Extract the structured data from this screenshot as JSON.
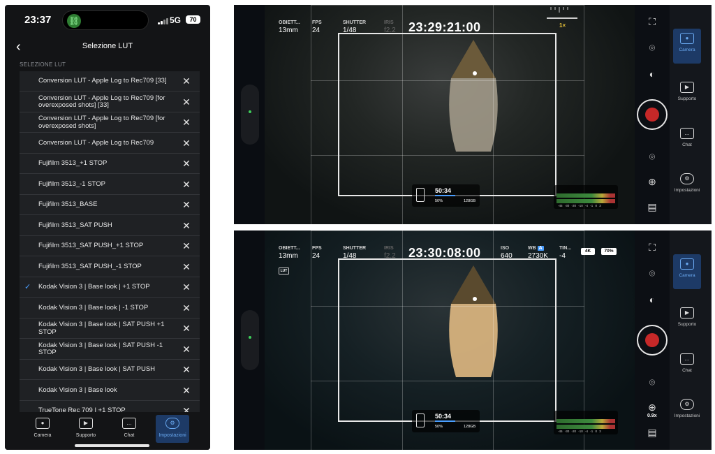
{
  "phone": {
    "status": {
      "time": "23:37",
      "network": "5G",
      "battery": "70"
    },
    "nav": {
      "back_icon": "chevron-left-icon",
      "title": "Selezione LUT"
    },
    "section_label": "SELEZIONE LUT",
    "luts": [
      {
        "label": "Conversion LUT - Apple Log to Rec709 [33]",
        "selected": false
      },
      {
        "label": "Conversion LUT - Apple Log to Rec709 [for overexposed shots] [33]",
        "selected": false
      },
      {
        "label": "Conversion LUT - Apple Log to Rec709 [for overexposed shots]",
        "selected": false
      },
      {
        "label": "Conversion LUT - Apple Log to Rec709",
        "selected": false
      },
      {
        "label": "Fujifilm 3513_+1 STOP",
        "selected": false
      },
      {
        "label": "Fujifilm 3513_-1 STOP",
        "selected": false
      },
      {
        "label": "Fujifilm 3513_BASE",
        "selected": false
      },
      {
        "label": "Fujifilm 3513_SAT PUSH",
        "selected": false
      },
      {
        "label": "Fujifilm 3513_SAT PUSH_+1 STOP",
        "selected": false
      },
      {
        "label": "Fujifilm 3513_SAT PUSH_-1 STOP",
        "selected": false
      },
      {
        "label": "Kodak Vision 3 | Base look | +1 STOP",
        "selected": true
      },
      {
        "label": "Kodak Vision 3 | Base look | -1 STOP",
        "selected": false
      },
      {
        "label": "Kodak Vision 3 | Base look | SAT PUSH +1 STOP",
        "selected": false
      },
      {
        "label": "Kodak Vision 3 | Base look | SAT PUSH -1 STOP",
        "selected": false
      },
      {
        "label": "Kodak Vision 3 | Base look | SAT PUSH",
        "selected": false
      },
      {
        "label": "Kodak Vision 3 | Base look",
        "selected": false
      },
      {
        "label": "TrueTone Rec 709 | +1 STOP",
        "selected": false
      }
    ],
    "tabs": [
      {
        "label": "Camera",
        "icon": "camera-icon",
        "active": false
      },
      {
        "label": "Supporto",
        "icon": "play-icon",
        "active": false
      },
      {
        "label": "Chat",
        "icon": "chat-icon",
        "active": false
      },
      {
        "label": "Impostazioni",
        "icon": "gear-icon",
        "active": true
      }
    ],
    "colors": {
      "accent": "#4a9eff",
      "active_tab_bg": "#1d3a66"
    }
  },
  "camera_screens": [
    {
      "lens": {
        "label": "OBIETT...",
        "value": "13mm"
      },
      "fps": {
        "label": "FPS",
        "value": "24"
      },
      "shutter": {
        "label": "SHUTTER",
        "value": "1/48"
      },
      "iris": {
        "label": "IRIS",
        "value": "f2.2"
      },
      "timecode": "23:29:21:00",
      "zoom": "1×",
      "storage": {
        "duration": "50:34",
        "percent": "50%",
        "capacity": "128GB",
        "fill": 0.5
      },
      "meter_scale": "-45 -30 -20 -10 -4 -1 0 3",
      "sidebar": [
        {
          "label": "Camera",
          "icon": "camera-icon",
          "active": true
        },
        {
          "label": "Supporto",
          "icon": "play-icon",
          "active": false
        },
        {
          "label": "Chat",
          "icon": "chat-icon",
          "active": false
        },
        {
          "label": "Impostazioni",
          "icon": "gear-icon",
          "active": false
        }
      ]
    },
    {
      "lens": {
        "label": "OBIETT...",
        "value": "13mm"
      },
      "fps": {
        "label": "FPS",
        "value": "24"
      },
      "shutter": {
        "label": "SHUTTER",
        "value": "1/48"
      },
      "iris": {
        "label": "IRIS",
        "value": "f2.2"
      },
      "timecode": "23:30:08:00",
      "iso": {
        "label": "ISO",
        "value": "640"
      },
      "wb": {
        "label": "WB",
        "mode": "A",
        "value": "2730K"
      },
      "tint": {
        "label": "TIN...",
        "value": "-4"
      },
      "resolution_badge": "4K",
      "battery_badge": "70%",
      "lut_badge": "LUT",
      "zoom_level": "0.9x",
      "storage": {
        "duration": "50:34",
        "percent": "50%",
        "capacity": "128GB",
        "fill": 0.5
      },
      "meter_scale": "-45 -30 -20 -10 -4 -1 0 3",
      "sidebar": [
        {
          "label": "Camera",
          "icon": "camera-icon",
          "active": true
        },
        {
          "label": "Supporto",
          "icon": "play-icon",
          "active": false
        },
        {
          "label": "Chat",
          "icon": "chat-icon",
          "active": false
        },
        {
          "label": "Impostazioni",
          "icon": "gear-icon",
          "active": false
        }
      ]
    }
  ]
}
